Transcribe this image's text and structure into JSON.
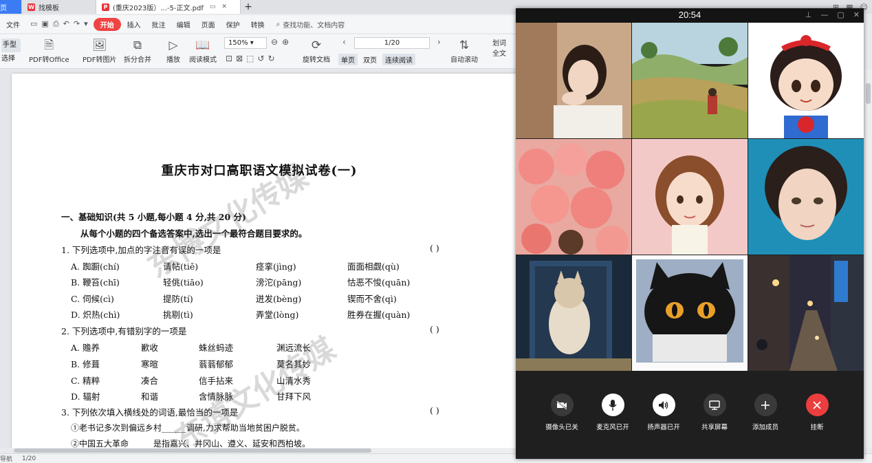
{
  "tabs": {
    "home": "页",
    "templates": "找模板",
    "document": "(重庆2023版）...-5-正文.pdf",
    "add": "+"
  },
  "toolbar": {
    "file": "文件",
    "start": "开始",
    "insert": "插入",
    "annotate": "批注",
    "edit": "编辑",
    "page": "页面",
    "protect": "保护",
    "convert": "转换",
    "search_placeholder": "查找功能、文档内容"
  },
  "ribbon": {
    "hand": "手型",
    "select": "选择",
    "pdf_to_office": "PDF转Office",
    "pdf_to_image": "PDF转图片",
    "split_merge": "拆分合并",
    "play": "播放",
    "read_mode": "阅读模式",
    "zoom": "150%",
    "rotate": "旋转文档",
    "page_indicator": "1/20",
    "single_page": "单页",
    "double_page": "双页",
    "continuous": "连续阅读",
    "auto_scroll": "自动滚动",
    "underline": "划词",
    "full_text": "全文"
  },
  "document": {
    "title": "重庆市对口高职语文模拟试卷(一)",
    "section1": "一、基础知识(共 5 小题,每小题 4 分,共 20 分)",
    "instruction": "从每个小题的四个备选答案中,选出一个最符合题目要求的。",
    "paren": "(       )",
    "q1": {
      "text": "1. 下列选项中,加点的字注音有误的一项是",
      "options": [
        [
          "A. 踟蹰(chí)",
          "请帖(tiě)",
          "痉挛(jìng)",
          "面面相觑(qù)"
        ],
        [
          "B. 鞭笞(chī)",
          "轻佻(tiāo)",
          "滂沱(pāng)",
          "怙恶不悛(quān)"
        ],
        [
          "C. 伺候(cì)",
          "提防(tí)",
          "迸发(bèng)",
          "锲而不舍(qì)"
        ],
        [
          "D. 炽热(chì)",
          "挑剔(tì)",
          "弄堂(lòng)",
          "胜券在握(quàn)"
        ]
      ]
    },
    "q2": {
      "text": "2. 下列选项中,有错别字的一项是",
      "options": [
        [
          "A. 赡养",
          "歉收",
          "蛛丝蚂迹",
          "渊远流长"
        ],
        [
          "B. 修葺",
          "寒暄",
          "蓊蓊郁郁",
          "莫名其妙"
        ],
        [
          "C. 精粹",
          "凑合",
          "信手拈来",
          "山清水秀"
        ],
        [
          "D. 辐射",
          "和谐",
          "含情脉脉",
          "甘拜下风"
        ]
      ]
    },
    "q3": {
      "text": "3. 下列依次填入横线处的词语,最恰当的一项是",
      "line1": "①老书记多次到偏远乡村______调研,力求帮助当地贫困户脱贫。",
      "line2": "②中国五大革命______是指嘉兴、井冈山、遵义、延安和西柏坡。"
    },
    "watermark": "东博文化传媒"
  },
  "status": {
    "label": "导航",
    "page": "1/20",
    "zoom": "150%"
  },
  "call": {
    "time": "20:54",
    "controls": {
      "camera": "摄像头已关",
      "mic": "麦克风已开",
      "speaker": "扬声器已开",
      "share": "共享屏幕",
      "add": "添加成员",
      "hangup": "挂断"
    },
    "colors": {
      "background": "#1f1f1f",
      "hangup": "#ec3e3e",
      "button": "#3a3a3a"
    }
  }
}
